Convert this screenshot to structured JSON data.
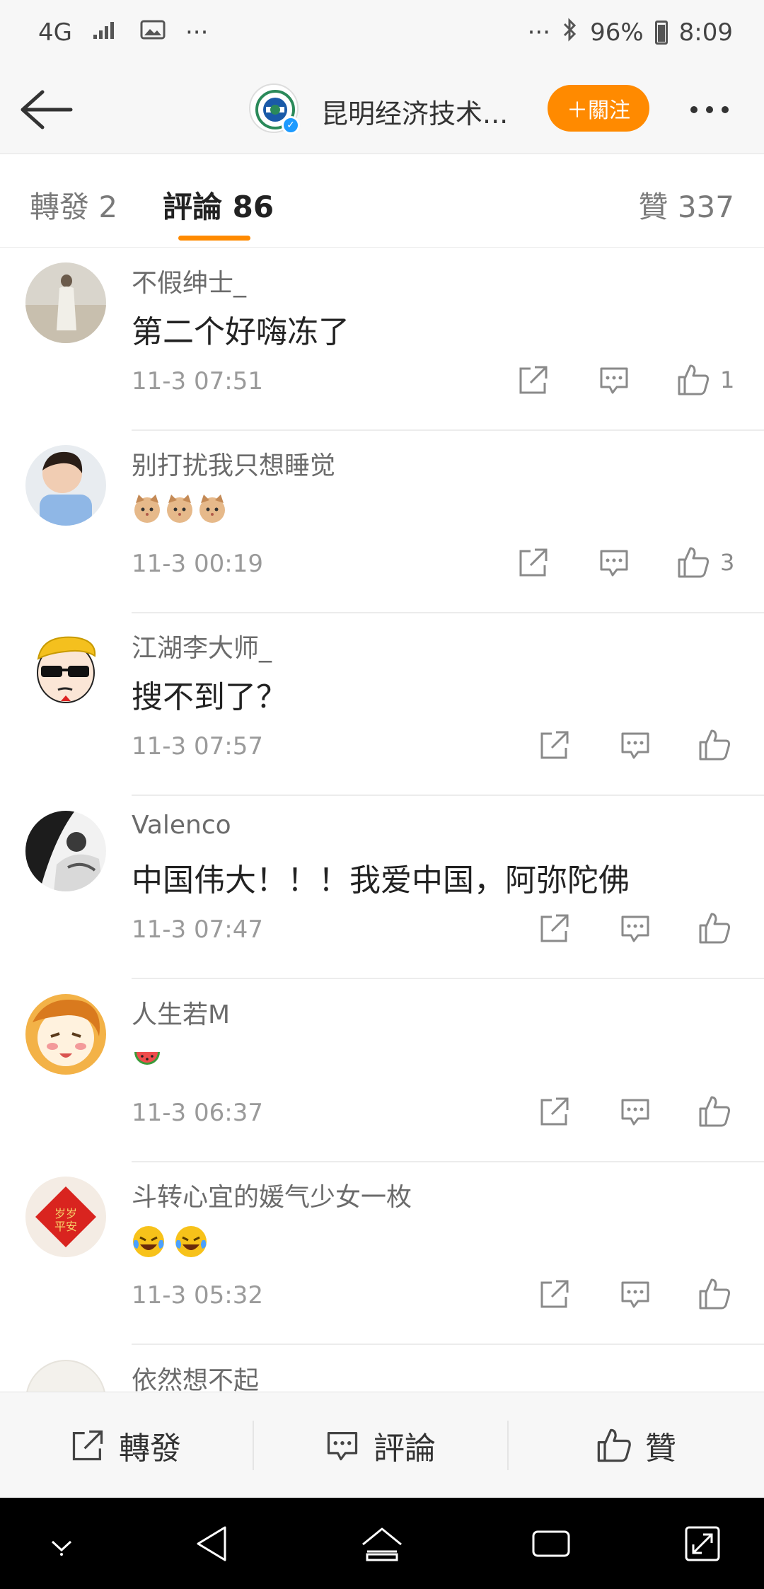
{
  "status_bar": {
    "network": "4G",
    "dots_left": "···",
    "dots_right": "···",
    "battery": "96%",
    "time": "8:09"
  },
  "nav": {
    "title": "昆明经济技术...",
    "follow_label": "＋關注"
  },
  "tabs": {
    "repost": "轉發 2",
    "comments": "評論 86",
    "likes": "贊 337"
  },
  "comments": [
    {
      "name": "不假绅士_",
      "text": "第二个好嗨冻了",
      "time": "11-3 07:51",
      "likes": "1",
      "emojis": []
    },
    {
      "name": "别打扰我只想睡觉",
      "text": "",
      "time": "11-3 00:19",
      "likes": "3",
      "emojis": [
        "cat-face",
        "cat-face",
        "cat-face"
      ]
    },
    {
      "name": "江湖李大师_",
      "text": "搜不到了？",
      "time": "11-3 07:57",
      "likes": "",
      "emojis": []
    },
    {
      "name": "Valenco",
      "text": "中国伟大！！！我爱中国，阿弥陀佛",
      "time": "11-3 07:47",
      "likes": "",
      "emojis": []
    },
    {
      "name": "人生若M",
      "text": "",
      "time": "11-3 06:37",
      "likes": "",
      "emojis": [
        "watermelon"
      ]
    },
    {
      "name": "斗转心宜的媛气少女一枚",
      "text": "",
      "time": "11-3 05:32",
      "likes": "",
      "emojis": [
        "laugh-cry",
        "laugh-cry"
      ]
    },
    {
      "name": "依然想不起",
      "text": "",
      "time": "",
      "likes": "",
      "emojis": []
    }
  ],
  "bottom_bar": {
    "repost": "轉發",
    "comment": "評論",
    "like": "贊"
  },
  "colors": {
    "accent": "#ff8a00",
    "verified": "#1e9bff"
  }
}
